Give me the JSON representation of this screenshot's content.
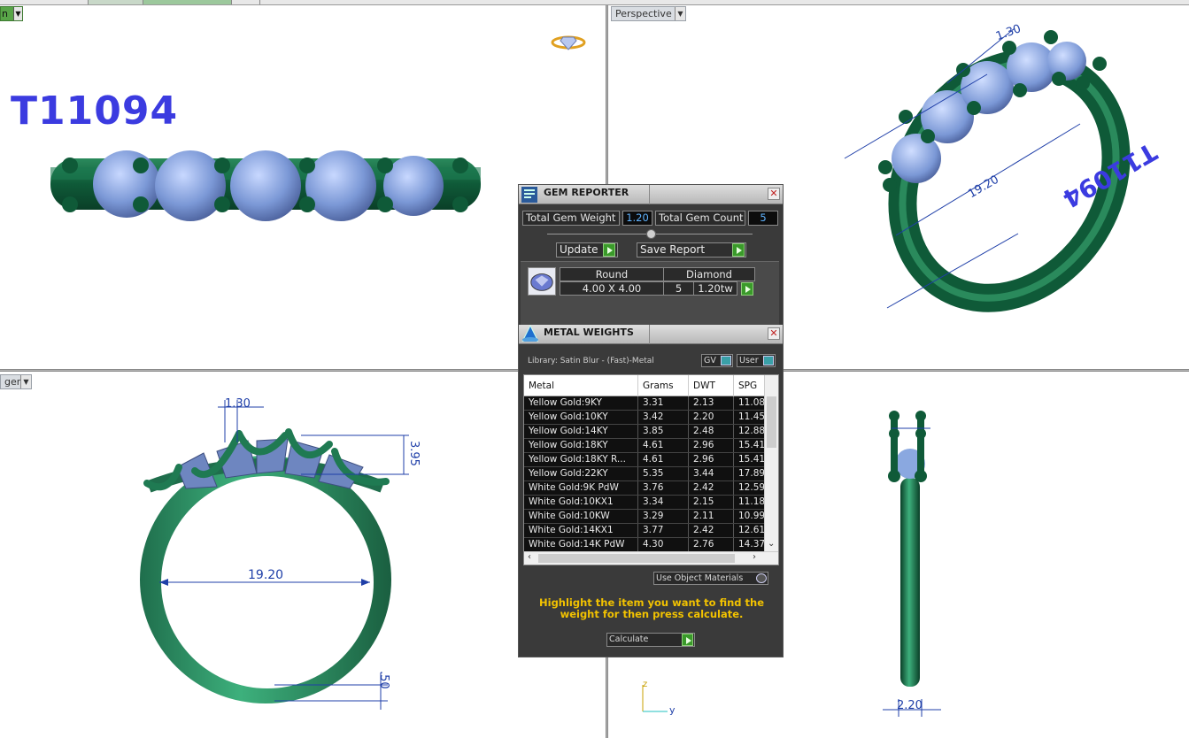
{
  "model": {
    "title": "T11094"
  },
  "viewports": {
    "top_left": {
      "label": "n"
    },
    "top_right": {
      "label": "Perspective"
    },
    "bottom_left": {
      "label": "ger"
    }
  },
  "dimensions": {
    "prong_width": "1.30",
    "height": "3.95",
    "inner_diameter": "19.20",
    "band_thickness": ".50",
    "side_width": "2.20",
    "persp_prong": "1.30",
    "persp_diameter": "19.20",
    "persp_engrave": "T11094"
  },
  "axes": {
    "z": "z",
    "y": "y"
  },
  "gem_reporter": {
    "title": "GEM REPORTER",
    "total_weight_label": "Total Gem Weight",
    "total_weight_value": "1.20",
    "total_count_label": "Total Gem Count",
    "total_count_value": "5",
    "update_label": "Update",
    "save_label": "Save Report",
    "gem": {
      "shape": "Round",
      "type": "Diamond",
      "size": "4.00 X 4.00",
      "count": "5",
      "weight": "1.20tw"
    }
  },
  "metal_weights": {
    "title": "METAL WEIGHTS",
    "library": "Library: Satin Blur - (Fast)-Metal",
    "gv_label": "GV",
    "user_label": "User",
    "columns": [
      "Metal",
      "Grams",
      "DWT",
      "SPG"
    ],
    "rows": [
      [
        "Yellow Gold:9KY",
        "3.31",
        "2.13",
        "11.08"
      ],
      [
        "Yellow Gold:10KY",
        "3.42",
        "2.20",
        "11.45"
      ],
      [
        "Yellow Gold:14KY",
        "3.85",
        "2.48",
        "12.88"
      ],
      [
        "Yellow Gold:18KY",
        "4.61",
        "2.96",
        "15.41"
      ],
      [
        "Yellow Gold:18KY R...",
        "4.61",
        "2.96",
        "15.41"
      ],
      [
        "Yellow Gold:22KY",
        "5.35",
        "3.44",
        "17.89"
      ],
      [
        "White Gold:9K PdW",
        "3.76",
        "2.42",
        "12.59"
      ],
      [
        "White Gold:10KX1",
        "3.34",
        "2.15",
        "11.18"
      ],
      [
        "White Gold:10KW",
        "3.29",
        "2.11",
        "10.99"
      ],
      [
        "White Gold:14KX1",
        "3.77",
        "2.42",
        "12.61"
      ],
      [
        "White Gold:14K PdW",
        "4.30",
        "2.76",
        "14.37"
      ]
    ],
    "use_object_materials": "Use Object Materials",
    "hint": "Highlight the item you want to find the weight for then press calculate.",
    "calculate_label": "Calculate"
  },
  "colors": {
    "metal_green": "#1f6e4c",
    "gem_blue": "#8aa8e0",
    "dimension_blue": "#1f3fa8",
    "title_blue": "#3b3be0",
    "hint_yellow": "#f2c200",
    "value_blue": "#5fb3ff"
  }
}
